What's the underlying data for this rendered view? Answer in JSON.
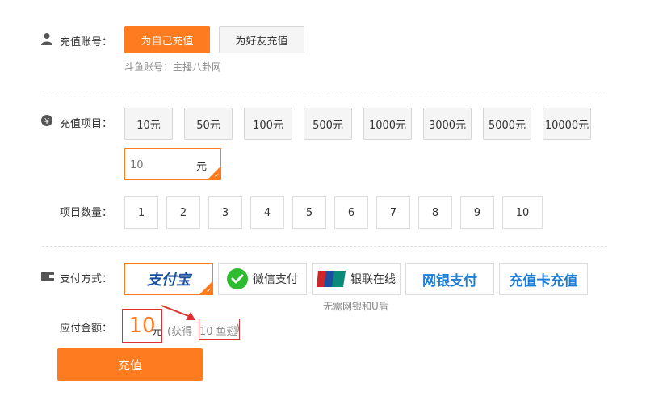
{
  "account": {
    "label": "充值账号：",
    "self_button": "为自己充值",
    "friend_button": "为好友充值",
    "douyu_account": "斗鱼账号：主播八卦网"
  },
  "project": {
    "label": "充值项目：",
    "amounts": [
      "10元",
      "50元",
      "100元",
      "500元",
      "1000元",
      "3000元",
      "5000元",
      "10000元"
    ],
    "custom_value": "10",
    "custom_unit": "元"
  },
  "quantity": {
    "label": "项目数量：",
    "options": [
      "1",
      "2",
      "3",
      "4",
      "5",
      "6",
      "7",
      "8",
      "9",
      "10"
    ]
  },
  "payment": {
    "label": "支付方式：",
    "alipay_label": "支付宝",
    "wechat_label": "微信支付",
    "unionpay_label": "银联在线",
    "unionpay_note": "无需网银和U盾",
    "netbank_label": "网银支付",
    "card_label": "充值卡充值"
  },
  "due": {
    "label": "应付金额：",
    "amount": "10",
    "unit": "元",
    "gain_prefix": "(获得",
    "gain_value": "10 鱼翅",
    "gain_suffix": ")"
  },
  "submit_label": "充值",
  "colors": {
    "accent": "#ff7b1f",
    "highlight_red": "#e03030",
    "link_blue": "#1e7dd6",
    "wechat_green": "#2fbb2f"
  }
}
